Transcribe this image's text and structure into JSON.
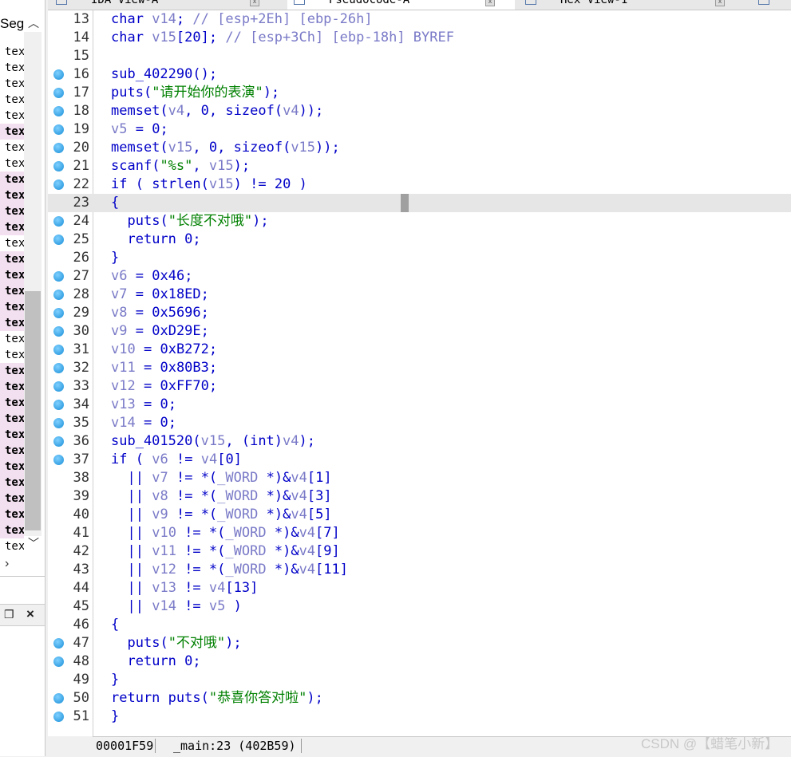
{
  "tabs": [
    {
      "label": "IDA View-A"
    },
    {
      "label": "Pseudocode-A"
    },
    {
      "label": "Hex View-1"
    }
  ],
  "sidebar": {
    "header": "Segments",
    "items": [
      {
        "label": "text",
        "highlighted": false
      },
      {
        "label": "text",
        "highlighted": false
      },
      {
        "label": "text",
        "highlighted": false
      },
      {
        "label": "text",
        "highlighted": false
      },
      {
        "label": "text",
        "highlighted": false
      },
      {
        "label": "text",
        "highlighted": true
      },
      {
        "label": "text",
        "highlighted": false
      },
      {
        "label": "text",
        "highlighted": false
      },
      {
        "label": "text",
        "highlighted": true
      },
      {
        "label": "text",
        "highlighted": true
      },
      {
        "label": "text",
        "highlighted": true
      },
      {
        "label": "text",
        "highlighted": true
      },
      {
        "label": "text",
        "highlighted": false
      },
      {
        "label": "text",
        "highlighted": true
      },
      {
        "label": "text",
        "highlighted": true
      },
      {
        "label": "text",
        "highlighted": true
      },
      {
        "label": "text",
        "highlighted": true
      },
      {
        "label": "text",
        "highlighted": true
      },
      {
        "label": "text",
        "highlighted": false
      },
      {
        "label": "text",
        "highlighted": false
      },
      {
        "label": "text",
        "highlighted": true
      },
      {
        "label": "text",
        "highlighted": true
      },
      {
        "label": "text",
        "highlighted": true
      },
      {
        "label": "text",
        "highlighted": true
      },
      {
        "label": "text",
        "highlighted": true
      },
      {
        "label": "text",
        "highlighted": true
      },
      {
        "label": "text",
        "highlighted": true
      },
      {
        "label": "text",
        "highlighted": true
      },
      {
        "label": "text",
        "highlighted": true
      },
      {
        "label": "text",
        "highlighted": true
      },
      {
        "label": "text",
        "highlighted": true
      },
      {
        "label": "text",
        "highlighted": false
      }
    ]
  },
  "code_lines": [
    {
      "num": "13",
      "dot": false,
      "text": "char v14; // [esp+2Eh] [ebp-26h]"
    },
    {
      "num": "14",
      "dot": false,
      "text": "char v15[20]; // [esp+3Ch] [ebp-18h] BYREF"
    },
    {
      "num": "15",
      "dot": false,
      "text": ""
    },
    {
      "num": "16",
      "dot": true,
      "text": "sub_402290();"
    },
    {
      "num": "17",
      "dot": true,
      "text": "puts(\"请开始你的表演\");"
    },
    {
      "num": "18",
      "dot": true,
      "text": "memset(v4, 0, sizeof(v4));"
    },
    {
      "num": "19",
      "dot": true,
      "text": "v5 = 0;"
    },
    {
      "num": "20",
      "dot": true,
      "text": "memset(v15, 0, sizeof(v15));"
    },
    {
      "num": "21",
      "dot": true,
      "text": "scanf(\"%s\", v15);"
    },
    {
      "num": "22",
      "dot": true,
      "text": "if ( strlen(v15) != 20 )"
    },
    {
      "num": "23",
      "dot": false,
      "text": "{"
    },
    {
      "num": "24",
      "dot": true,
      "text": "  puts(\"长度不对哦\");"
    },
    {
      "num": "25",
      "dot": true,
      "text": "  return 0;"
    },
    {
      "num": "26",
      "dot": false,
      "text": "}"
    },
    {
      "num": "27",
      "dot": true,
      "text": "v6 = 0x46;"
    },
    {
      "num": "28",
      "dot": true,
      "text": "v7 = 0x18ED;"
    },
    {
      "num": "29",
      "dot": true,
      "text": "v8 = 0x5696;"
    },
    {
      "num": "30",
      "dot": true,
      "text": "v9 = 0xD29E;"
    },
    {
      "num": "31",
      "dot": true,
      "text": "v10 = 0xB272;"
    },
    {
      "num": "32",
      "dot": true,
      "text": "v11 = 0x80B3;"
    },
    {
      "num": "33",
      "dot": true,
      "text": "v12 = 0xFF70;"
    },
    {
      "num": "34",
      "dot": true,
      "text": "v13 = 0;"
    },
    {
      "num": "35",
      "dot": true,
      "text": "v14 = 0;"
    },
    {
      "num": "36",
      "dot": true,
      "text": "sub_401520(v15, (int)v4);"
    },
    {
      "num": "37",
      "dot": true,
      "text": "if ( v6 != v4[0]"
    },
    {
      "num": "38",
      "dot": false,
      "text": "  || v7 != *(_WORD *)&v4[1]"
    },
    {
      "num": "39",
      "dot": false,
      "text": "  || v8 != *(_WORD *)&v4[3]"
    },
    {
      "num": "40",
      "dot": false,
      "text": "  || v9 != *(_WORD *)&v4[5]"
    },
    {
      "num": "41",
      "dot": false,
      "text": "  || v10 != *(_WORD *)&v4[7]"
    },
    {
      "num": "42",
      "dot": false,
      "text": "  || v11 != *(_WORD *)&v4[9]"
    },
    {
      "num": "43",
      "dot": false,
      "text": "  || v12 != *(_WORD *)&v4[11]"
    },
    {
      "num": "44",
      "dot": false,
      "text": "  || v13 != v4[13]"
    },
    {
      "num": "45",
      "dot": false,
      "text": "  || v14 != v5 )"
    },
    {
      "num": "46",
      "dot": false,
      "text": "{"
    },
    {
      "num": "47",
      "dot": true,
      "text": "  puts(\"不对哦\");"
    },
    {
      "num": "48",
      "dot": true,
      "text": "  return 0;"
    },
    {
      "num": "49",
      "dot": false,
      "text": "}"
    },
    {
      "num": "50",
      "dot": true,
      "text": "return puts(\"恭喜你答对啦\");"
    },
    {
      "num": "51",
      "dot": true,
      "text": "}"
    }
  ],
  "current_line_num": "23",
  "status": {
    "address": "00001F59",
    "location": "_main:23 (402B59)"
  },
  "watermark": "CSDN @【蜡笔小新】",
  "colors": {
    "keyword": "#0000c8",
    "variable": "#7a7ac8",
    "string": "#008000",
    "dot": "#1a8fd8"
  }
}
